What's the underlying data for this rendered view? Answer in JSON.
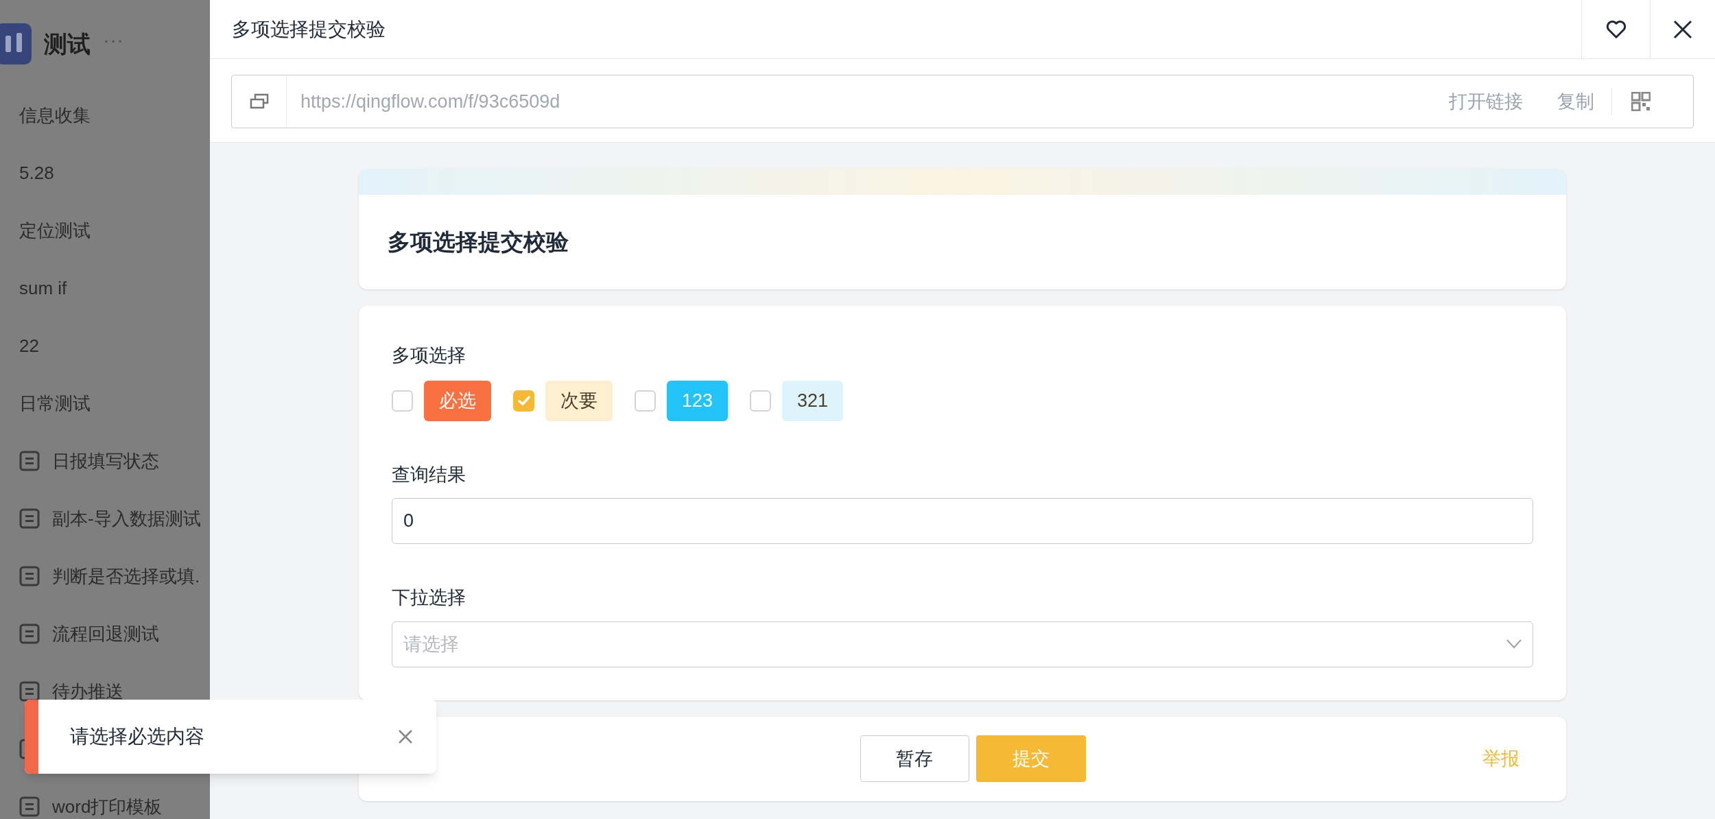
{
  "sidebar": {
    "app_title": "测试",
    "more": "···",
    "items": [
      {
        "label": "信息收集"
      },
      {
        "label": "5.28"
      },
      {
        "label": "定位测试"
      },
      {
        "label": "sum if"
      },
      {
        "label": "22"
      },
      {
        "label": "日常测试",
        "children": [
          {
            "kind": "form",
            "label": "日报填写状态"
          },
          {
            "kind": "form",
            "label": "副本-导入数据测试"
          },
          {
            "kind": "form",
            "label": "判断是否选择或填."
          },
          {
            "kind": "form",
            "label": "流程回退测试"
          },
          {
            "kind": "form",
            "label": "待办推送"
          },
          {
            "kind": "covered"
          },
          {
            "kind": "form",
            "label": "word打印模板"
          }
        ]
      }
    ]
  },
  "drawer": {
    "title": "多项选择提交校验",
    "url": "https://qingflow.com/f/93c6509d",
    "open_link": "打开链接",
    "copy": "复制"
  },
  "form": {
    "title": "多项选择提交校验",
    "fields": [
      {
        "kind": "checkboxes",
        "label": "多项选择",
        "options": [
          {
            "label": "必选",
            "checked": false,
            "color": "#f97140",
            "kind": "solid"
          },
          {
            "label": "次要",
            "checked": true,
            "color": "#fdefd0",
            "kind": "soft"
          },
          {
            "label": "123",
            "checked": false,
            "color": "#22c4f7",
            "kind": "solid"
          },
          {
            "label": "321",
            "checked": false,
            "color": "#ddf4fc",
            "kind": "soft"
          }
        ]
      },
      {
        "kind": "text",
        "label": "查询结果",
        "value": "0"
      },
      {
        "kind": "select",
        "label": "下拉选择",
        "placeholder": "请选择"
      }
    ],
    "buttons": {
      "save": "暂存",
      "submit": "提交",
      "report": "举报"
    }
  },
  "toast": {
    "message": "请选择必选内容"
  }
}
